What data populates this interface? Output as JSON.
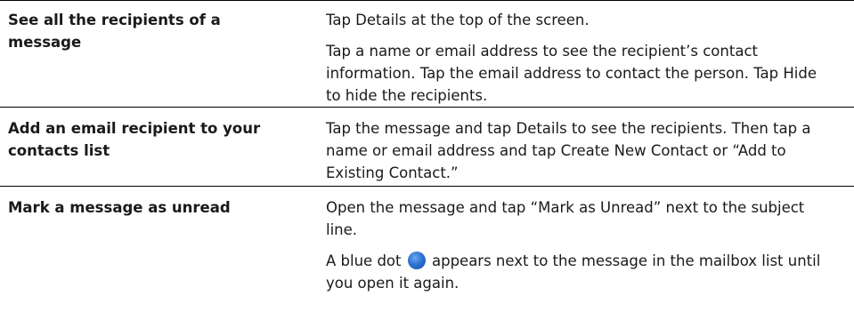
{
  "rows": [
    {
      "task": "See all the recipients of a message",
      "paragraphs": [
        "Tap Details at the top of the screen.",
        "Tap a name or email address to see the recipient’s contact information. Tap the email address to contact the person. Tap Hide to hide the recipients."
      ]
    },
    {
      "task": "Add an email recipient to your contacts list",
      "paragraphs": [
        "Tap the message and tap Details to see the recipients. Then tap a name or email address and tap Create New Contact or “Add to Existing Contact.”"
      ]
    },
    {
      "task": "Mark a message as unread",
      "paragraphs": [
        "Open the message and tap “Mark as Unread” next to the subject line."
      ],
      "dot_before": "A blue dot",
      "dot_after": "appears next to the message in the mailbox list until you open it again.",
      "dot_color": "#2f74d0"
    }
  ]
}
